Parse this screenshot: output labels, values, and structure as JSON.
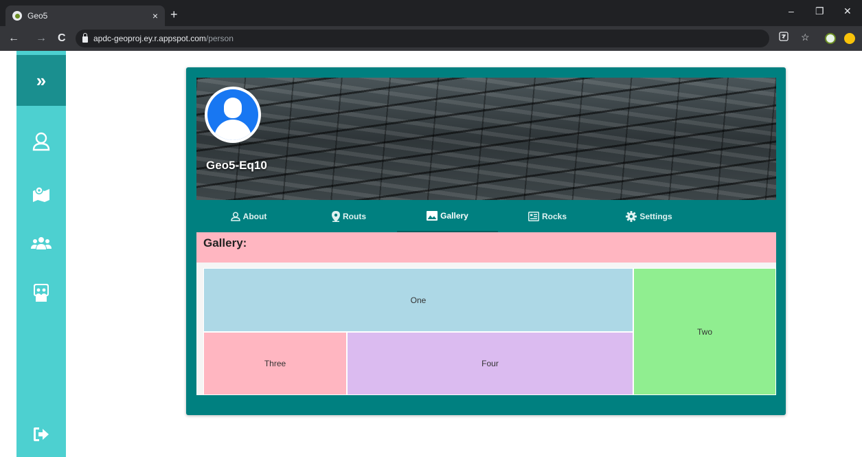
{
  "browser": {
    "tab_title": "Geo5",
    "tab_close": "×",
    "new_tab": "+",
    "url_host": "apdc-geoproj.ey.r.appspot.com",
    "url_path": "/person",
    "minimize": "–",
    "restore": "❐",
    "close": "✕",
    "back": "←",
    "forward": "→",
    "reload": "C"
  },
  "sidebar": {
    "toggle": "»"
  },
  "profile": {
    "username": "Geo5-Eq10"
  },
  "tabs": [
    {
      "label": "About"
    },
    {
      "label": "Routs"
    },
    {
      "label": "Gallery"
    },
    {
      "label": "Rocks"
    },
    {
      "label": "Settings"
    }
  ],
  "gallery": {
    "title": "Gallery:",
    "cells": [
      {
        "label": "One",
        "color": "#add8e6"
      },
      {
        "label": "Two",
        "color": "#90ee90"
      },
      {
        "label": "Three",
        "color": "#ffb6c1"
      },
      {
        "label": "Four",
        "color": "#dbbbf0"
      }
    ]
  },
  "colors": {
    "sidebar": "#4dd0d0",
    "card": "#008080",
    "accent": "#1a8f8f"
  }
}
